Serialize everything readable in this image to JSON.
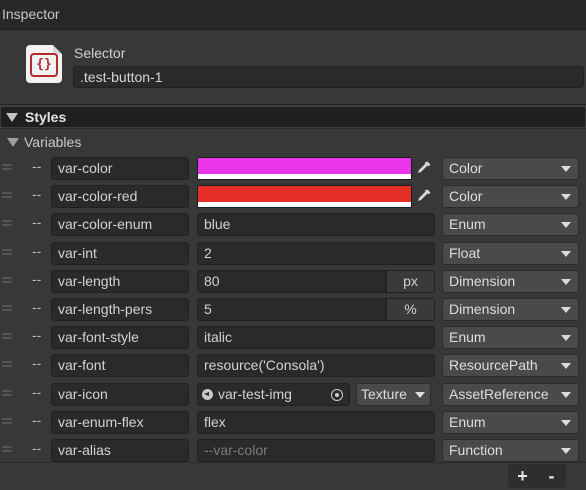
{
  "window": {
    "title": "Inspector"
  },
  "selector": {
    "label": "Selector",
    "value": ".test-button-1",
    "icon": "stylesheet-braces-icon",
    "icon_glyph": "{}"
  },
  "styles": {
    "label": "Styles"
  },
  "variables": {
    "label": "Variables",
    "rows": [
      {
        "dashes": "--",
        "name": "var-color",
        "kind": "color",
        "color": "#ea36ea",
        "type": "Color"
      },
      {
        "dashes": "--",
        "name": "var-color-red",
        "kind": "color",
        "color": "#e52e25",
        "type": "Color"
      },
      {
        "dashes": "--",
        "name": "var-color-enum",
        "kind": "text",
        "value": "blue",
        "type": "Enum"
      },
      {
        "dashes": "--",
        "name": "var-int",
        "kind": "text",
        "value": "2",
        "type": "Float"
      },
      {
        "dashes": "--",
        "name": "var-length",
        "kind": "unit",
        "value": "80",
        "unit": "px",
        "type": "Dimension"
      },
      {
        "dashes": "--",
        "name": "var-length-pers",
        "kind": "unit",
        "value": "5",
        "unit": "%",
        "type": "Dimension"
      },
      {
        "dashes": "--",
        "name": "var-font-style",
        "kind": "text",
        "value": "italic",
        "type": "Enum"
      },
      {
        "dashes": "--",
        "name": "var-font",
        "kind": "text",
        "value": "resource('Consola')",
        "type": "ResourcePath"
      },
      {
        "dashes": "--",
        "name": "var-icon",
        "kind": "asset",
        "value": "var-test-img",
        "asset_type": "Texture",
        "type": "AssetReference"
      },
      {
        "dashes": "--",
        "name": "var-enum-flex",
        "kind": "text",
        "value": "flex",
        "type": "Enum"
      },
      {
        "dashes": "--",
        "name": "var-alias",
        "kind": "placeholder",
        "placeholder": "--var-color",
        "type": "Function"
      }
    ]
  },
  "footer": {
    "add_label": "+",
    "remove_label": "-"
  }
}
